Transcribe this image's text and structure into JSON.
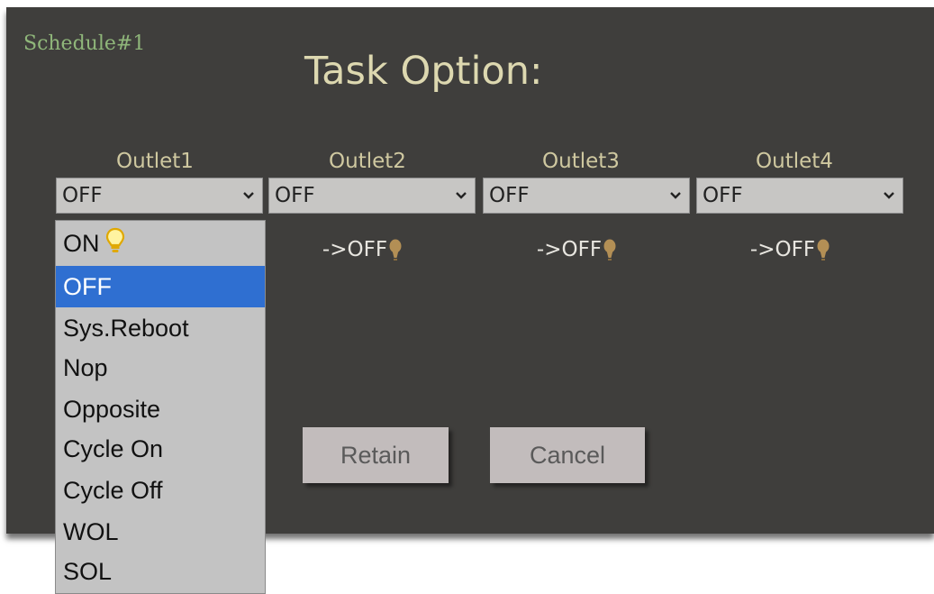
{
  "header": {
    "schedule_label": "Schedule#1",
    "title": "Task Option:"
  },
  "outlets": [
    {
      "label": "Outlet1",
      "selected": "OFF"
    },
    {
      "label": "Outlet2",
      "selected": "OFF",
      "state": "->OFF"
    },
    {
      "label": "Outlet3",
      "selected": "OFF",
      "state": "->OFF"
    },
    {
      "label": "Outlet4",
      "selected": "OFF",
      "state": "->OFF"
    }
  ],
  "dropdown": {
    "options": [
      "ON",
      "OFF",
      "Sys.Reboot",
      "Nop",
      "Opposite",
      "Cycle On",
      "Cycle Off",
      "WOL",
      "SOL"
    ],
    "highlighted": "OFF"
  },
  "buttons": {
    "retain_label": "Retain",
    "cancel_label": "Cancel"
  },
  "icons": {
    "on_bulb": "lightbulb-outline-icon",
    "off_bulb": "lightbulb-filled-icon",
    "chevron": "chevron-down-icon"
  },
  "colors": {
    "panel_bg": "#3f3e3c",
    "title": "#ddd8b0",
    "schedule_label": "#8fb67a",
    "highlight": "#2f6fd1",
    "bulb_on": "#f5c400",
    "bulb_off": "#b38f55",
    "button_bg": "#c2bcbc"
  }
}
